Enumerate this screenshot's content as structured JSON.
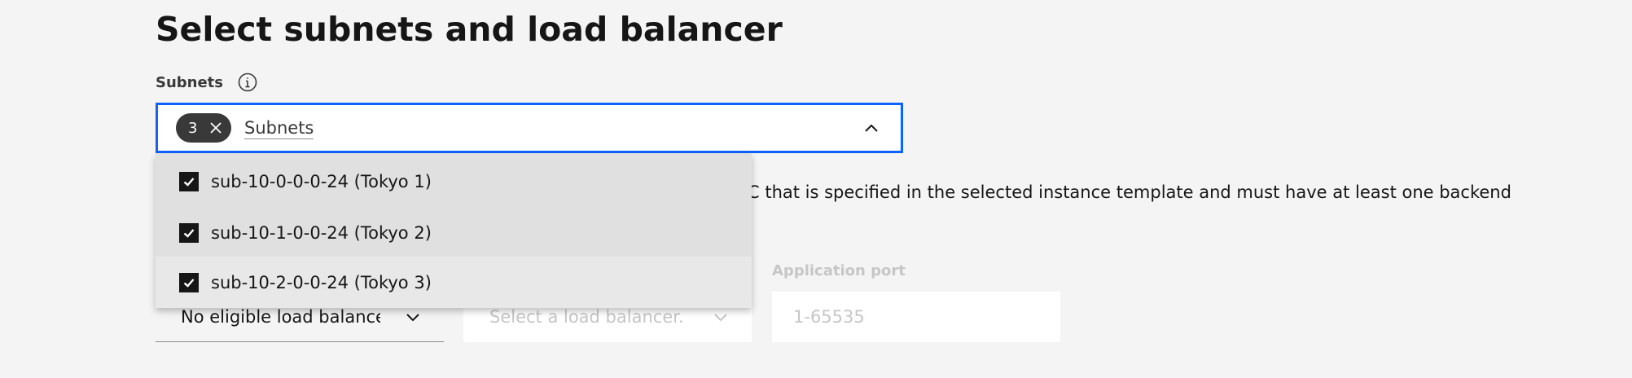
{
  "page": {
    "title": "Select subnets and load balancer"
  },
  "subnets": {
    "label": "Subnets",
    "selected_count": "3",
    "placeholder": "Subnets",
    "options": [
      {
        "label": "sub-10-0-0-0-24 (Tokyo 1)",
        "checked": true
      },
      {
        "label": "sub-10-1-0-0-24 (Tokyo 2)",
        "checked": true
      },
      {
        "label": "sub-10-2-0-0-24 (Tokyo 3)",
        "checked": true
      }
    ]
  },
  "helper_text": "C that is specified in the selected instance template and must have at least one backend",
  "load_balancer": {
    "type_value": "No eligible load balancer",
    "select_placeholder": "Select a load balancer."
  },
  "application_port": {
    "label": "Application port",
    "placeholder": "1-65535"
  },
  "colors": {
    "focus": "#0f62fe",
    "tag": "#393939",
    "menu": "#e0e0e0",
    "disabled_text": "#c6c6c6"
  }
}
